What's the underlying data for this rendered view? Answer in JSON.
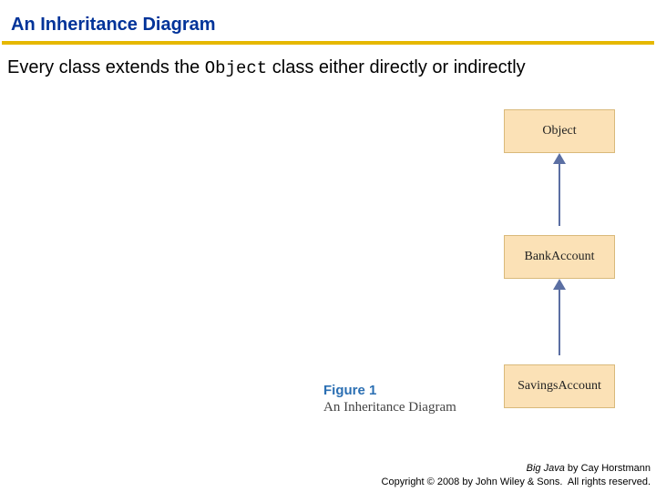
{
  "title": "An Inheritance Diagram",
  "body": {
    "prefix": "Every class extends the ",
    "code": "Object",
    "suffix": " class either directly or indirectly"
  },
  "diagram": {
    "classes": {
      "object": "Object",
      "bankAccount": "BankAccount",
      "savingsAccount": "SavingsAccount"
    }
  },
  "figure": {
    "number": "Figure 1",
    "caption": "An Inheritance Diagram"
  },
  "footer": {
    "line1_book": "Big Java",
    "line1_rest": " by Cay Horstmann",
    "line2": "Copyright © 2008 by John Wiley & Sons.  All rights reserved."
  }
}
